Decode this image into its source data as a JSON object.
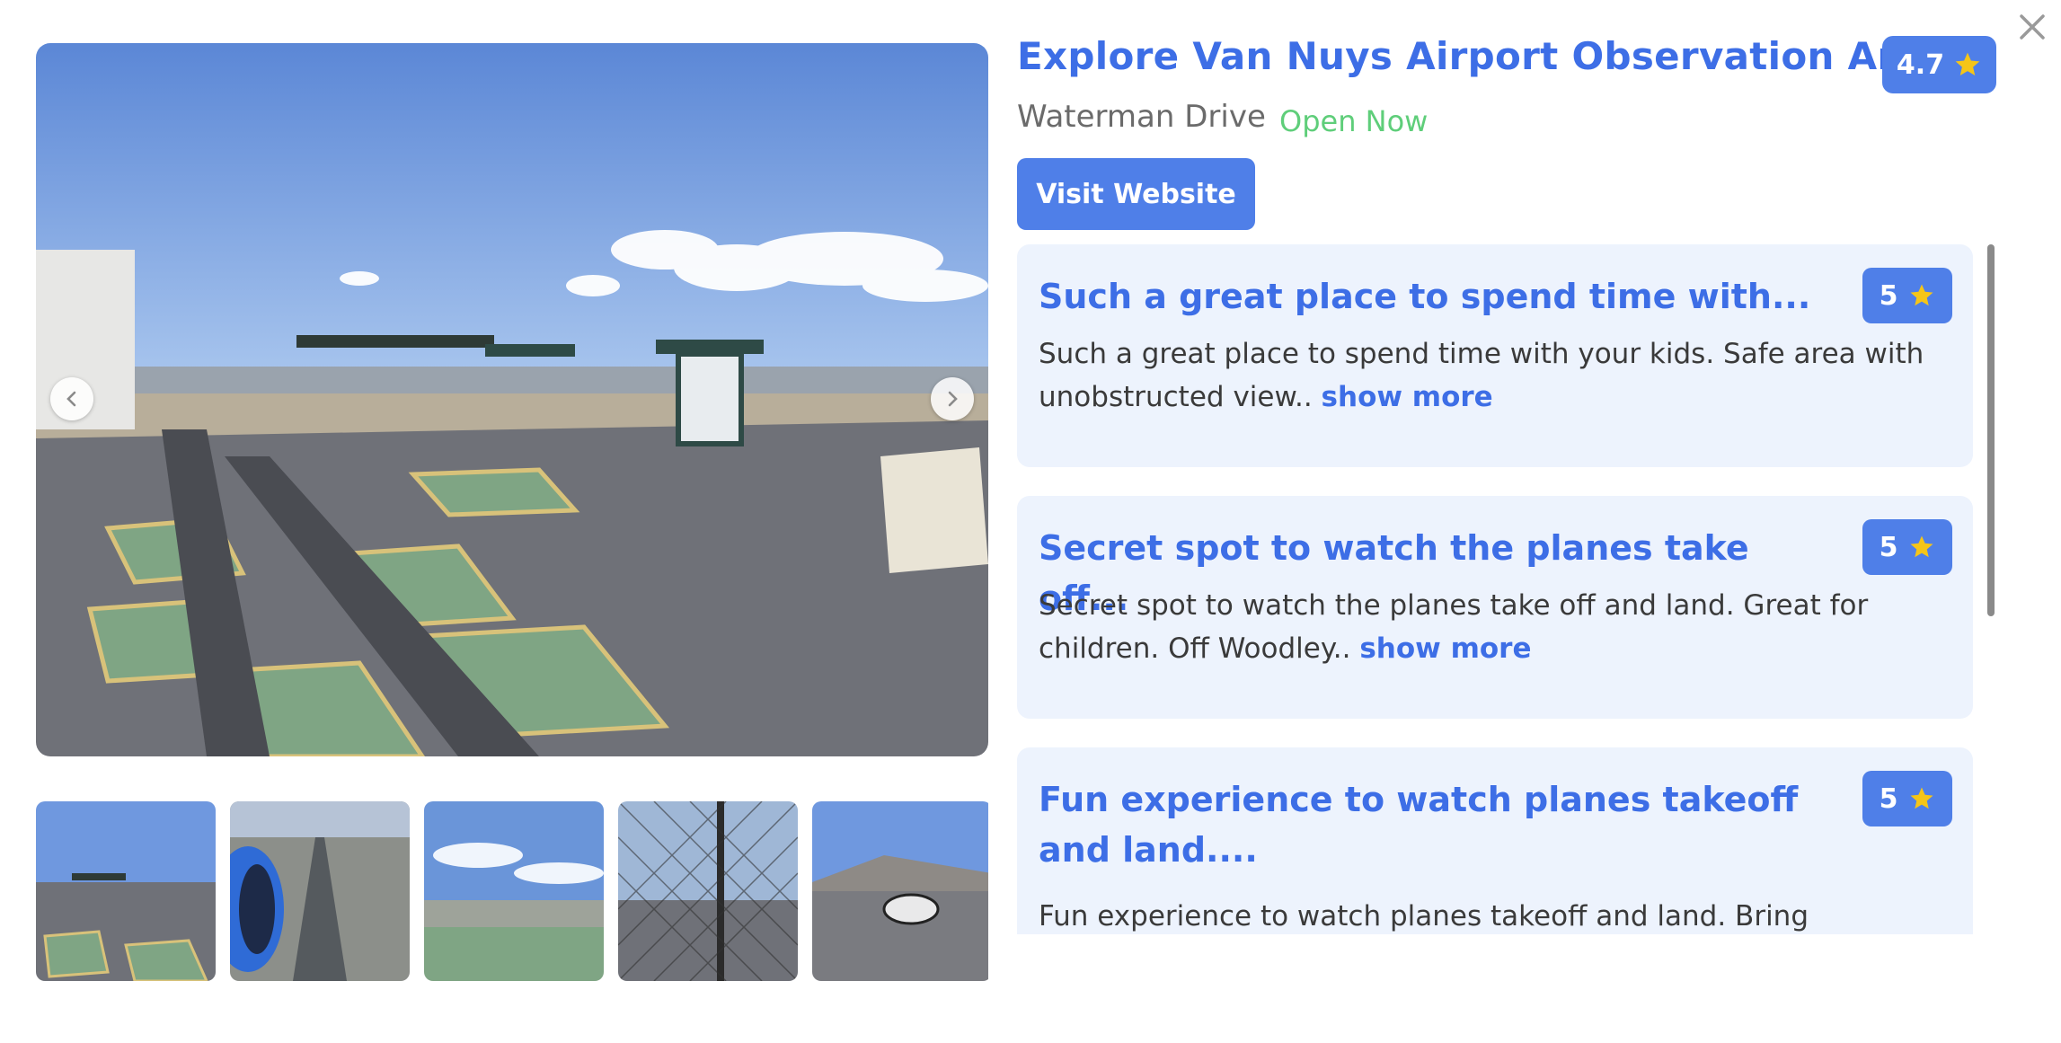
{
  "title": "Explore Van Nuys Airport Observation Area",
  "rating": "4.7",
  "address": "Waterman Drive",
  "status": "Open Now",
  "visit_button": "Visit Website",
  "colors": {
    "accent": "#4f7fe8",
    "title": "#3d6ee6",
    "open": "#5fce7a",
    "review_bg": "#edf3fd",
    "star": "#f5c518"
  },
  "icons": {
    "close": "close-icon",
    "prev": "chevron-left-icon",
    "next": "chevron-right-icon",
    "star": "star-icon"
  },
  "reviews": [
    {
      "title": "Such a great place to spend time with...",
      "rating": "5",
      "text": "Such a great place to spend time with your kids. Safe area with unobstructed view..",
      "more": "show more"
    },
    {
      "title": "Secret spot to watch the planes take off...",
      "rating": "5",
      "text": "Secret spot to watch the planes take off and land. Great for children. Off Woodley..",
      "more": "show more"
    },
    {
      "title": "Fun experience to watch planes takeoff and land....",
      "rating": "5",
      "text": "Fun experience to watch planes takeoff and land. Bring binoculars if"
    }
  ]
}
